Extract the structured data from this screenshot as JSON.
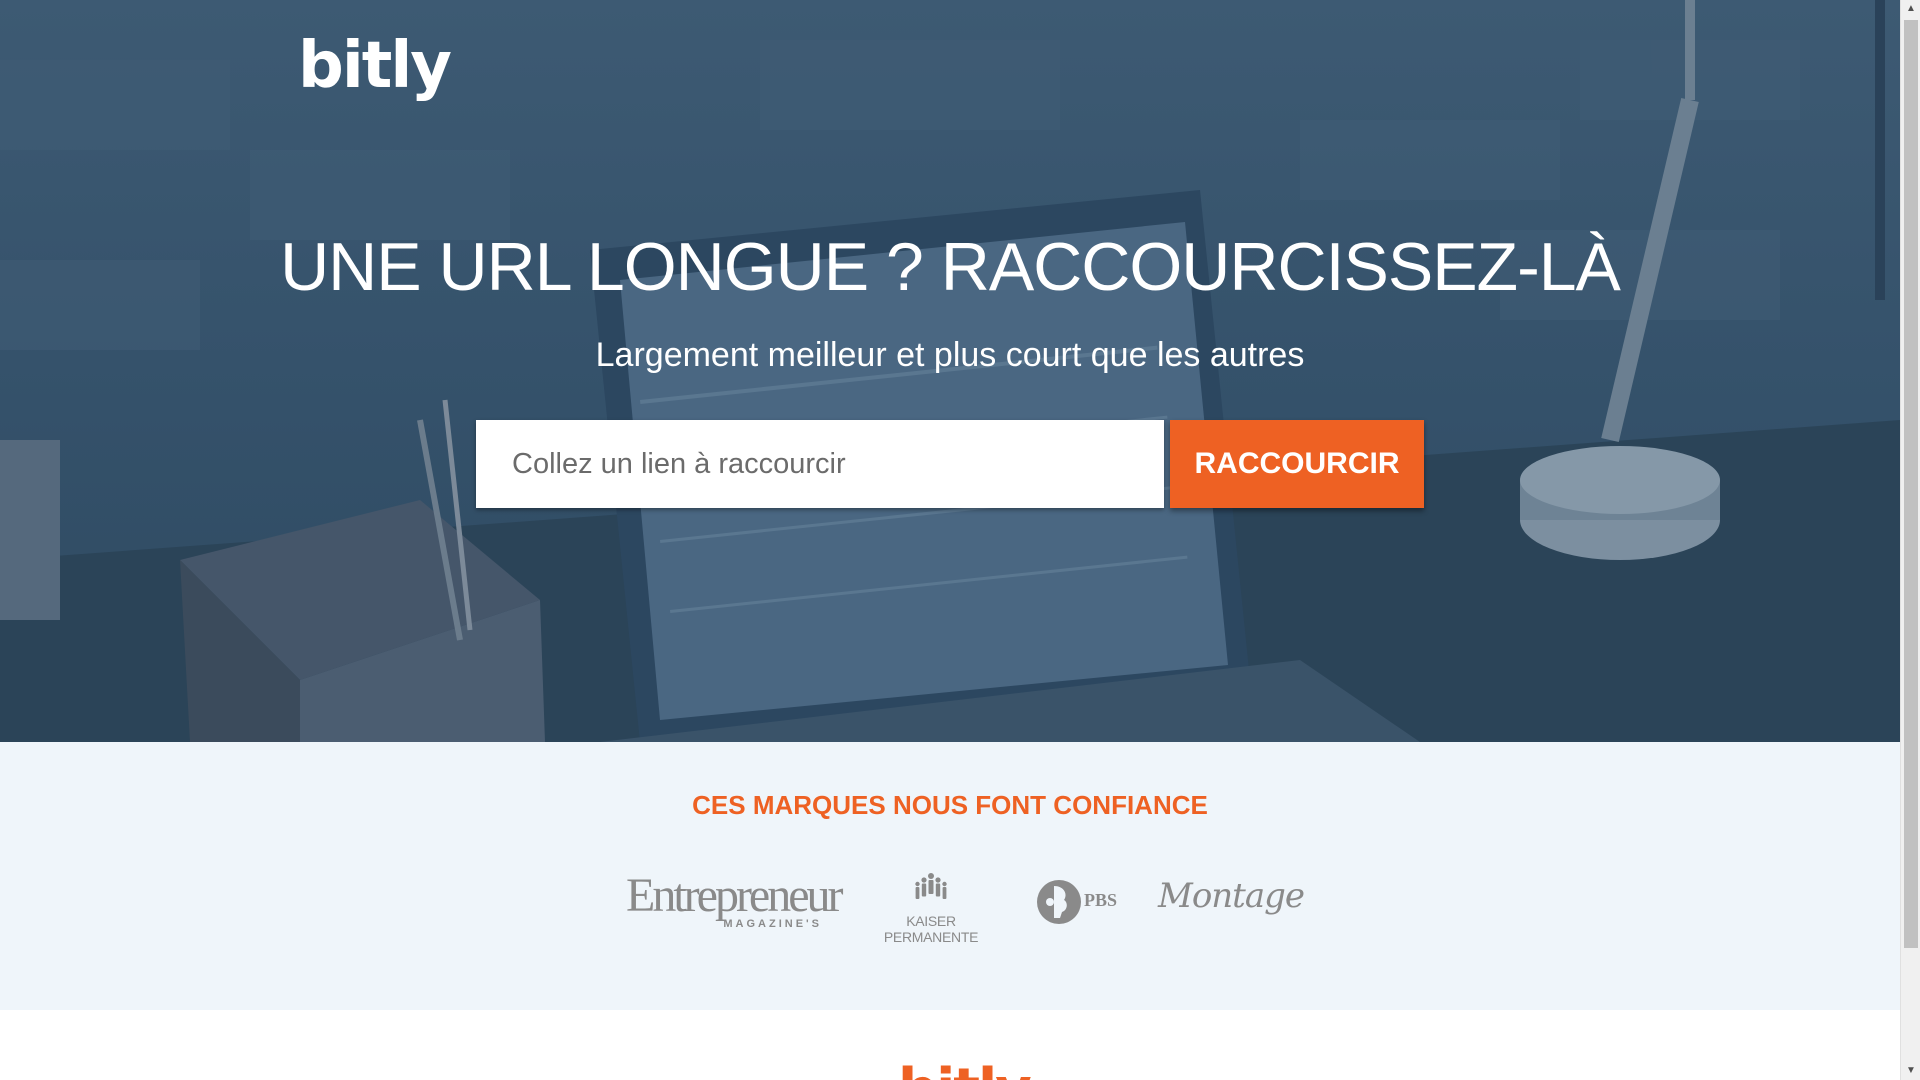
{
  "brand": {
    "logo_text": "bitly"
  },
  "hero": {
    "headline": "UNE URL LONGUE ? RACCOURCISSEZ-LÀ",
    "subheadline": "Largement meilleur et plus court que les autres",
    "input_placeholder": "Collez un lien à raccourcir",
    "input_value": "",
    "button_label": "RACCOURCIR"
  },
  "brands_section": {
    "title": "CES MARQUES NOUS FONT CONFIANCE",
    "logos": [
      {
        "name": "Entrepreneur",
        "subtext": "MAGAZINE'S"
      },
      {
        "name": "KAISER PERMANENTE"
      },
      {
        "name": "PBS"
      },
      {
        "name": "Montage"
      }
    ]
  },
  "footer_preview": {
    "logo_text": "bitly"
  },
  "colors": {
    "accent": "#ee6123",
    "hero_overlay": "#34516a",
    "brands_bg": "#eff5fa",
    "logo_gray": "#8a8a8a"
  },
  "icons": {
    "scroll_up": "scroll-up-arrow-icon",
    "scroll_down": "scroll-down-arrow-icon",
    "kaiser": "kaiser-people-icon",
    "pbs": "pbs-head-icon"
  }
}
